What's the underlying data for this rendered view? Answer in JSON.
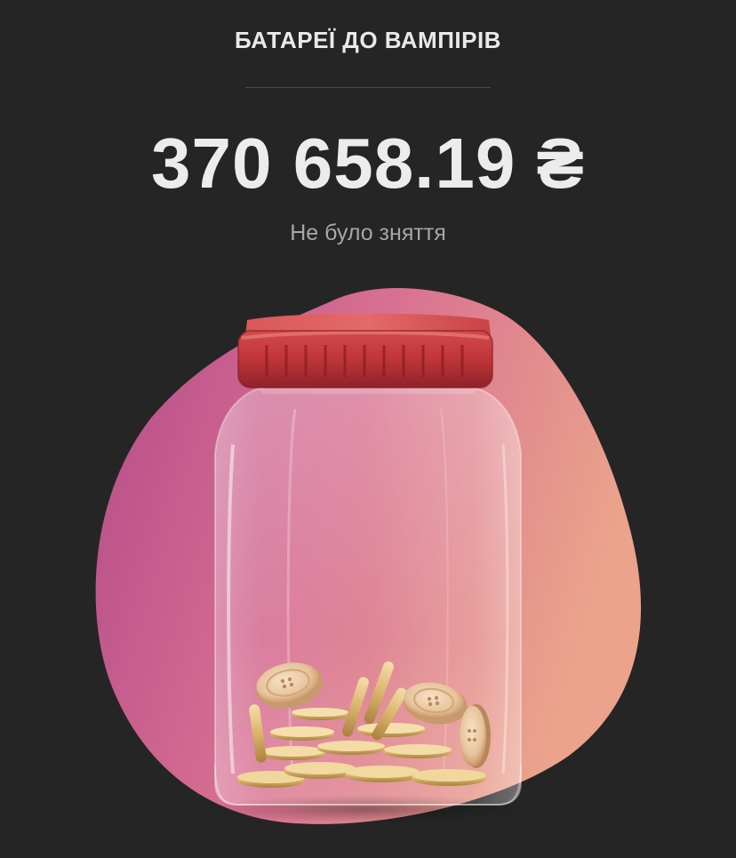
{
  "jar": {
    "title": "БАТАРЕЇ ДО ВАМПІРІВ",
    "balance": "370 658.19 ₴",
    "withdrawal_status": "Не було зняття"
  },
  "colors": {
    "background": "#252526",
    "blob_start": "#b64f8b",
    "blob_end": "#e99f8b",
    "lid": "#c5383c",
    "coin": "#e0c07a"
  },
  "icons": {
    "illustration": "jar-with-coins-icon"
  }
}
